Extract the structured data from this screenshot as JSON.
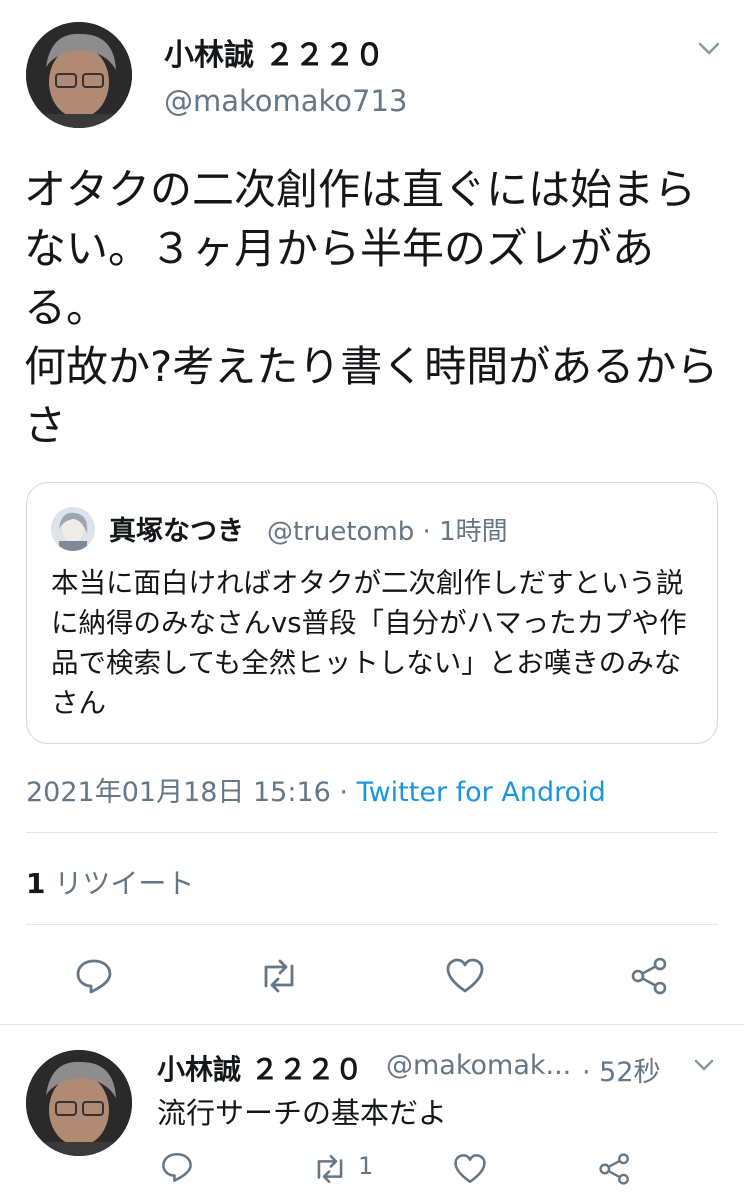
{
  "tweet": {
    "author_name": "小林誠 ２２２０",
    "author_handle": "@makomako713",
    "text": "オタクの二次創作は直ぐには始まらない。３ヶ月から半年のズレがある。\n何故か?考えたり書く時間があるからさ",
    "timestamp": "2021年01月18日 15:16",
    "separator": " · ",
    "source": "Twitter for Android",
    "retweet_count": "1",
    "retweet_label": " リツイート"
  },
  "quoted_tweet": {
    "author_name": "真塚なつき",
    "author_handle": "@truetomb · 1時間",
    "text": "本当に面白ければオタクが二次創作しだすという説に納得のみなさんvs普段「自分がハマったカプや作品で検索しても全然ヒットしない」とお嘆きのみなさん"
  },
  "reply": {
    "author_name": "小林誠 ２２２０",
    "author_handle": "@makomak...",
    "time": "· 52秒",
    "text": "流行サーチの基本だよ",
    "retweet_count": "1"
  },
  "icons": {
    "menu": "chevron-down-icon",
    "reply": "reply-icon",
    "retweet": "retweet-icon",
    "like": "heart-icon",
    "share": "share-icon"
  },
  "colors": {
    "text": "#14171a",
    "secondary": "#657786",
    "link": "#1b95e0",
    "border": "#e1e8ed"
  }
}
